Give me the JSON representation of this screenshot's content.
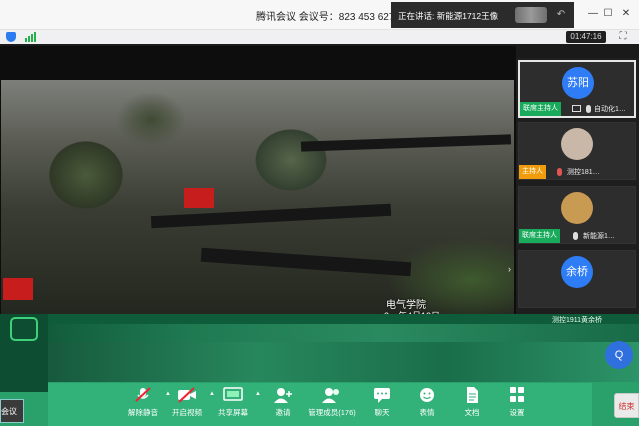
{
  "window": {
    "app_title": "腾讯会议 会议号：823 453 627",
    "speaking_label": "正在讲话: 新能源1712王像",
    "controls": {
      "pin": "⬚",
      "minimize": "—",
      "maximize": "☐",
      "close": "✕"
    }
  },
  "infobar": {
    "timer": "01:47:16"
  },
  "video": {
    "caption": "电气学院",
    "date_fragment": "2…年4月12日"
  },
  "participants": [
    {
      "avatar_text": "苏阳",
      "avatar_color": "#2e7cf6",
      "role": "联席主持人",
      "name": "自动化1…",
      "active": true
    },
    {
      "avatar_text": "",
      "avatar_color": "#c9b8a8",
      "role": "主持人",
      "name": "测控181…",
      "active": false
    },
    {
      "avatar_text": "",
      "avatar_color": "#c99a52",
      "role": "联席主持人",
      "name": "新能源1…",
      "active": false
    },
    {
      "avatar_text": "余桥",
      "avatar_color": "#2e7cf6",
      "role": "",
      "name": "测控1911黄余桥",
      "active": false
    }
  ],
  "toolbar": {
    "items": [
      {
        "label": "解除静音",
        "icon": "mic-off-icon"
      },
      {
        "label": "开启视频",
        "icon": "camera-off-icon"
      },
      {
        "label": "共享屏幕",
        "icon": "share-screen-icon"
      },
      {
        "label": "邀请",
        "icon": "invite-icon"
      },
      {
        "label": "管理成员(176)",
        "icon": "members-icon"
      },
      {
        "label": "聊天",
        "icon": "chat-icon"
      },
      {
        "label": "表情",
        "icon": "emoji-icon"
      },
      {
        "label": "文档",
        "icon": "document-icon"
      },
      {
        "label": "设置",
        "icon": "settings-icon"
      }
    ],
    "left_button": "会议",
    "end_button": "结束",
    "q_button": "Q"
  },
  "colors": {
    "toolbar": "#32b279",
    "co_host_badge": "#1aaa5c",
    "host_badge": "#f19c0c",
    "avatar_blue": "#2e7cf6"
  }
}
